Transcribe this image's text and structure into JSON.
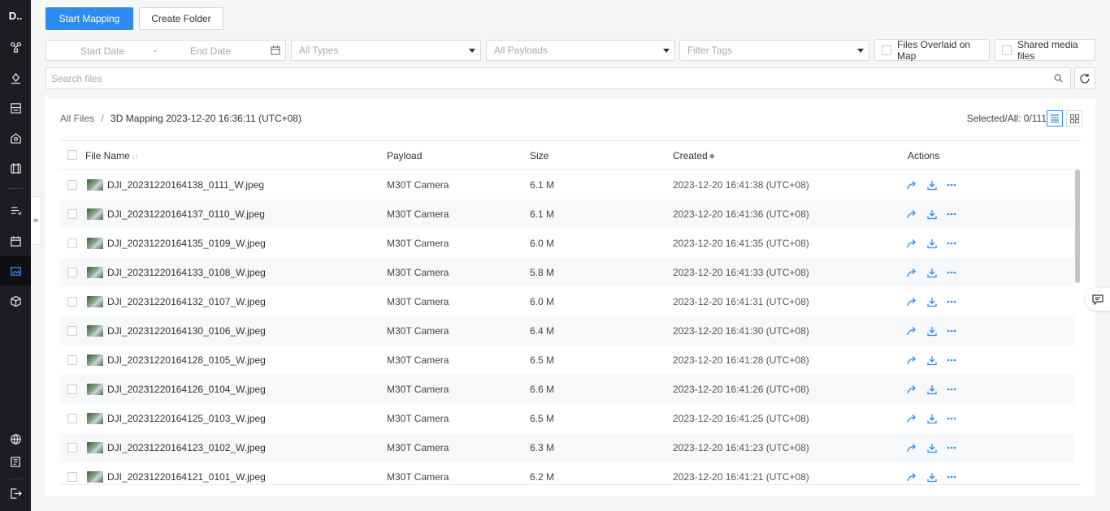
{
  "app": {
    "logo": "D.."
  },
  "toolbar": {
    "start_mapping": "Start Mapping",
    "create_folder": "Create Folder"
  },
  "filters": {
    "start_date": "Start Date",
    "date_sep": "-",
    "end_date": "End Date",
    "types": "All Types",
    "payloads": "All Payloads",
    "tags": "Filter Tags",
    "overlay_label": "Files Overlaid on Map",
    "shared_label": "Shared media files"
  },
  "search": {
    "placeholder": "Search files"
  },
  "breadcrumb": {
    "root": "All Files",
    "separator": "/",
    "current": "3D Mapping 2023-12-20 16:36:11 (UTC+08)"
  },
  "selection": {
    "text": "Selected/All: 0/111"
  },
  "table": {
    "headers": {
      "name": "File Name",
      "payload": "Payload",
      "size": "Size",
      "created": "Created",
      "actions": "Actions"
    },
    "rows": [
      {
        "name": "DJI_20231220164138_0111_W.jpeg",
        "payload": "M30T Camera",
        "size": "6.1 M",
        "created": "2023-12-20 16:41:38 (UTC+08)"
      },
      {
        "name": "DJI_20231220164137_0110_W.jpeg",
        "payload": "M30T Camera",
        "size": "6.1 M",
        "created": "2023-12-20 16:41:36 (UTC+08)"
      },
      {
        "name": "DJI_20231220164135_0109_W.jpeg",
        "payload": "M30T Camera",
        "size": "6.0 M",
        "created": "2023-12-20 16:41:35 (UTC+08)"
      },
      {
        "name": "DJI_20231220164133_0108_W.jpeg",
        "payload": "M30T Camera",
        "size": "5.8 M",
        "created": "2023-12-20 16:41:33 (UTC+08)"
      },
      {
        "name": "DJI_20231220164132_0107_W.jpeg",
        "payload": "M30T Camera",
        "size": "6.0 M",
        "created": "2023-12-20 16:41:31 (UTC+08)"
      },
      {
        "name": "DJI_20231220164130_0106_W.jpeg",
        "payload": "M30T Camera",
        "size": "6.4 M",
        "created": "2023-12-20 16:41:30 (UTC+08)"
      },
      {
        "name": "DJI_20231220164128_0105_W.jpeg",
        "payload": "M30T Camera",
        "size": "6.5 M",
        "created": "2023-12-20 16:41:28 (UTC+08)"
      },
      {
        "name": "DJI_20231220164126_0104_W.jpeg",
        "payload": "M30T Camera",
        "size": "6.6 M",
        "created": "2023-12-20 16:41:26 (UTC+08)"
      },
      {
        "name": "DJI_20231220164125_0103_W.jpeg",
        "payload": "M30T Camera",
        "size": "6.5 M",
        "created": "2023-12-20 16:41:25 (UTC+08)"
      },
      {
        "name": "DJI_20231220164123_0102_W.jpeg",
        "payload": "M30T Camera",
        "size": "6.3 M",
        "created": "2023-12-20 16:41:23 (UTC+08)"
      },
      {
        "name": "DJI_20231220164121_0101_W.jpeg",
        "payload": "M30T Camera",
        "size": "6.2 M",
        "created": "2023-12-20 16:41:21 (UTC+08)"
      }
    ]
  },
  "colors": {
    "accent": "#2d8cf0",
    "rail_bg": "#1b1d21",
    "page_bg": "#f5f6f8"
  },
  "icons": {
    "rail": [
      "drone-icon",
      "waypoint-icon",
      "device-icon",
      "dock-icon",
      "map-icon",
      "flight-task-icon",
      "calendar-icon",
      "media-icon",
      "model-icon",
      "globe-icon",
      "log-icon",
      "logout-icon"
    ],
    "row_actions": [
      "share-icon",
      "download-icon",
      "more-icon"
    ]
  }
}
